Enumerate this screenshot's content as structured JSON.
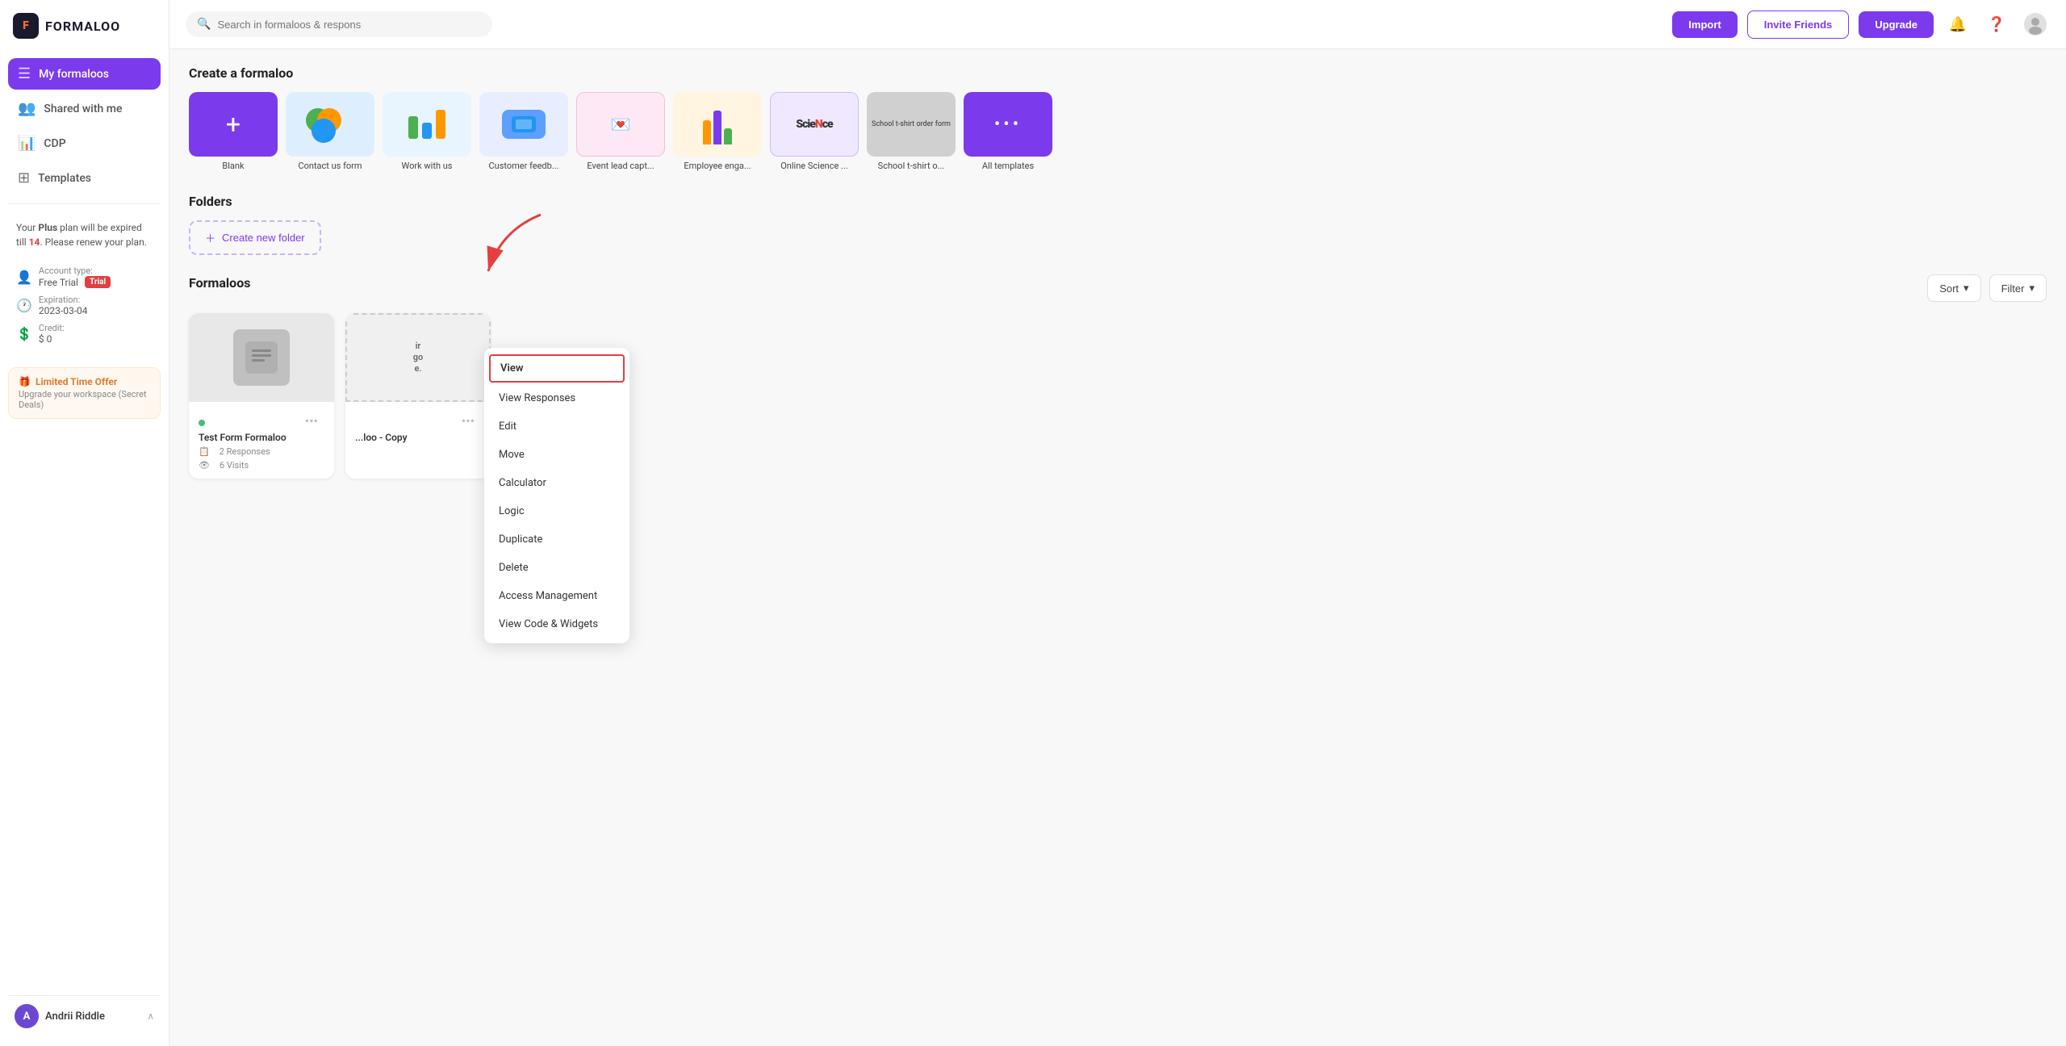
{
  "sidebar": {
    "logo_text": "FORMALOO",
    "nav_items": [
      {
        "id": "my-formaloos",
        "label": "My formaloos",
        "icon": "☰",
        "active": true
      },
      {
        "id": "shared-with-me",
        "label": "Shared with me",
        "icon": "👥",
        "active": false
      },
      {
        "id": "cdp",
        "label": "CDP",
        "icon": "📊",
        "active": false
      },
      {
        "id": "templates",
        "label": "Templates",
        "icon": "⊞",
        "active": false
      }
    ],
    "plan_warning": "Your ",
    "plan_bold": "Plus",
    "plan_mid": " plan will be expired till ",
    "plan_number": "14",
    "plan_end": ". Please renew your plan.",
    "account_type_label": "Account type:",
    "account_type_value": "Free Trial",
    "trial_badge": "Trial",
    "expiration_label": "Expiration:",
    "expiration_value": "2023-03-04",
    "credit_label": "Credit:",
    "credit_value": "$ 0",
    "limited_offer_title": "Limited Time Offer",
    "limited_offer_desc": "Upgrade your workspace (Secret Deals)",
    "user_name": "Andrii Riddle",
    "user_initial": "A"
  },
  "topbar": {
    "search_placeholder": "Search in formaloos & respons",
    "import_label": "Import",
    "invite_label": "Invite Friends",
    "upgrade_label": "Upgrade"
  },
  "create_section": {
    "title": "Create a formaloo",
    "templates": [
      {
        "id": "blank",
        "name": "Blank",
        "type": "blank"
      },
      {
        "id": "contact",
        "name": "Contact us form",
        "type": "contact"
      },
      {
        "id": "work",
        "name": "Work with us",
        "type": "work"
      },
      {
        "id": "customer",
        "name": "Customer feedb...",
        "type": "customer"
      },
      {
        "id": "event",
        "name": "Event lead capt...",
        "type": "event"
      },
      {
        "id": "employee",
        "name": "Employee enga...",
        "type": "employee"
      },
      {
        "id": "science",
        "name": "Online Science ...",
        "type": "science"
      },
      {
        "id": "school",
        "name": "School t-shirt o...",
        "type": "school"
      },
      {
        "id": "all",
        "name": "All templates",
        "type": "all-tpl"
      }
    ]
  },
  "folders_section": {
    "title": "Folders",
    "create_label": "Create new folder"
  },
  "formaloos_section": {
    "title": "Formaloos",
    "sort_label": "Sort",
    "filter_label": "Filter",
    "cards": [
      {
        "id": "test-form",
        "name": "Test Form Formaloo",
        "status": "active",
        "responses": "2 Responses",
        "visits": "6 Visits"
      },
      {
        "id": "copy",
        "name": "...loo - Copy",
        "status": "copy",
        "responses": "",
        "visits": ""
      }
    ]
  },
  "context_menu": {
    "items": [
      {
        "id": "view",
        "label": "View",
        "highlighted": true
      },
      {
        "id": "view-responses",
        "label": "View Responses",
        "highlighted": false
      },
      {
        "id": "edit",
        "label": "Edit",
        "highlighted": false
      },
      {
        "id": "move",
        "label": "Move",
        "highlighted": false
      },
      {
        "id": "calculator",
        "label": "Calculator",
        "highlighted": false
      },
      {
        "id": "logic",
        "label": "Logic",
        "highlighted": false
      },
      {
        "id": "duplicate",
        "label": "Duplicate",
        "highlighted": false
      },
      {
        "id": "delete",
        "label": "Delete",
        "highlighted": false
      },
      {
        "id": "access-management",
        "label": "Access Management",
        "highlighted": false
      },
      {
        "id": "view-code",
        "label": "View Code & Widgets",
        "highlighted": false
      }
    ]
  }
}
